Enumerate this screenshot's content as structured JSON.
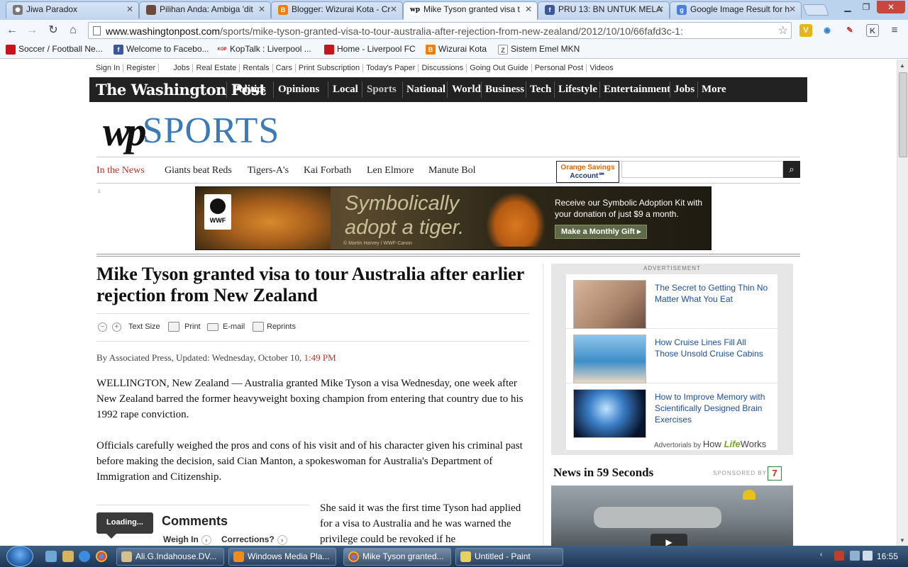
{
  "browser": {
    "tabs": [
      {
        "title": "Jiwa Paradox",
        "active": false
      },
      {
        "title": "Pilihan Anda: Ambiga 'dit",
        "active": false
      },
      {
        "title": "Blogger: Wizurai Kota - Cr",
        "active": false
      },
      {
        "title": "Mike Tyson granted visa t",
        "active": true
      },
      {
        "title": "PRU 13: BN UNTUK MELA",
        "active": false
      },
      {
        "title": "Google Image Result for h",
        "active": false
      }
    ],
    "url_host": "www.washingtonpost.com",
    "url_path": "/sports/mike-tyson-granted-visa-to-tour-australia-after-rejection-from-new-zealand/2012/10/10/66fafd3c-1:",
    "bookmarks": [
      "Soccer / Football Ne...",
      "Welcome to Facebo...",
      "KopTalk : Liverpool ...",
      "Home - Liverpool FC",
      "Wizurai Kota",
      "Sistem Emel MKN"
    ],
    "bookmark_icon_text": [
      "",
      "f",
      "KOP",
      "",
      "B",
      "Z"
    ]
  },
  "utility_links": [
    "Sign In",
    "Register",
    "Jobs",
    "Real Estate",
    "Rentals",
    "Cars",
    "Print Subscription",
    "Today's Paper",
    "Discussions",
    "Going Out Guide",
    "Personal Post",
    "Videos"
  ],
  "nav": {
    "logo": "The Washington Post",
    "items": [
      "Politics",
      "Opinions",
      "Local",
      "Sports",
      "National",
      "World",
      "Business",
      "Tech",
      "Lifestyle",
      "Entertainment",
      "Jobs",
      "More"
    ]
  },
  "section_logo": {
    "wp": "wp",
    "name": "SPORTS"
  },
  "in_the_news": {
    "label": "In the News",
    "items": [
      "Giants beat Reds",
      "Tigers-A's",
      "Kai Forbath",
      "Len Elmore",
      "Manute Bol"
    ]
  },
  "orange_ad": {
    "line1": "Orange Savings",
    "line2": "Account℠"
  },
  "search": {
    "placeholder": ""
  },
  "banner_ad": {
    "org": "WWF",
    "slogan_1": "Symbolically",
    "slogan_2": "adopt a tiger.",
    "copy": "Receive our Symbolic Adoption Kit with your donation of just $9 a month.",
    "cta": "Make a Monthly Gift ▸",
    "credit": "© Martin Harvey / WWF-Canon"
  },
  "article": {
    "headline": "Mike Tyson granted visa to tour Australia after earlier rejection from New Zealand",
    "tools": {
      "text_size": "Text Size",
      "print": "Print",
      "email": "E-mail",
      "reprints": "Reprints"
    },
    "byline_prefix": "By Associated Press, Updated: Wednesday, October 10,",
    "byline_time": "1:49 PM",
    "paragraphs": [
      "WELLINGTON, New Zealand — Australia granted Mike Tyson a visa Wednesday, one week after New Zealand barred the former heavyweight boxing champion from entering that country due to his 1992 rape conviction.",
      "Officials carefully weighed the pros and cons of his visit and of his character given his criminal past before making the decision, said Cian Manton, a spokeswoman for Australia's Department of Immigration and Citizenship."
    ],
    "side_paragraph": "She said it was the first time Tyson had applied for a visa to Australia and he was warned the privilege could be revoked if he"
  },
  "comments": {
    "loading": "Loading...",
    "title": "Comments",
    "weigh_in": "Weigh In",
    "corrections": "Corrections?"
  },
  "sidebar_ad": {
    "label": "ADVERTISEMENT",
    "items": [
      "The Secret to Getting Thin No Matter What You Eat",
      "How Cruise Lines Fill All Those Unsold Cruise Cabins",
      "How to Improve Memory with Scientifically Designed Brain Exercises"
    ],
    "advertorials_by": "Advertorials by",
    "brand_how": "How",
    "brand_life": "Life",
    "brand_works": "Works"
  },
  "news59": {
    "title": "News in 59 Seconds",
    "sponsored": "SPONSORED BY",
    "sponsor_mark": "7"
  },
  "taskbar": {
    "tasks": [
      "Ali.G.Indahouse.DV...",
      "Windows Media Pla...",
      "Mike Tyson granted...",
      "Untitled - Paint"
    ],
    "clock": "16:55"
  },
  "colors": {
    "accent_red": "#b5352a",
    "sports_blue": "#3a7ab8",
    "nav_bg": "#222222",
    "ad_link": "#1c4fa0"
  }
}
